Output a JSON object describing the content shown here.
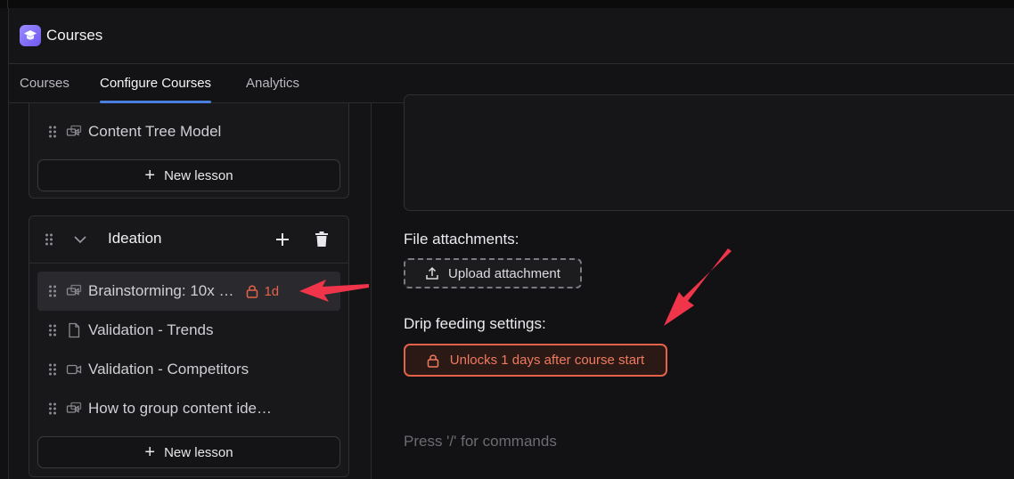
{
  "app": {
    "title": "Courses",
    "icon": "graduation-cap-icon",
    "accent": "#7c66f5"
  },
  "tabs": [
    {
      "label": "Courses",
      "active": false
    },
    {
      "label": "Configure Courses",
      "active": true
    },
    {
      "label": "Analytics",
      "active": false
    }
  ],
  "sidebar": {
    "prev_section": {
      "lessons": [
        {
          "title": "Content Tree Model",
          "type": "mixed-media-icon"
        }
      ],
      "new_lesson_label": "New lesson"
    },
    "section": {
      "title": "Ideation",
      "lessons": [
        {
          "title": "Brainstorming: 10x …",
          "type": "mixed-media-icon",
          "badge": "1d",
          "locked": true,
          "selected": true
        },
        {
          "title": "Validation - Trends",
          "type": "document-icon"
        },
        {
          "title": "Validation - Competitors",
          "type": "video-icon"
        },
        {
          "title": "How to group content ide…",
          "type": "mixed-media-icon"
        }
      ],
      "new_lesson_label": "New lesson"
    }
  },
  "main": {
    "attachments_label": "File attachments:",
    "upload_label": "Upload attachment",
    "drip_label": "Drip feeding settings:",
    "drip_button": "Unlocks 1 days after course start",
    "editor_placeholder": "Press '/' for commands"
  },
  "colors": {
    "lock_red": "#e5624a",
    "tab_underline": "#4a7fe0",
    "annotation_arrow": "#f0344a"
  }
}
